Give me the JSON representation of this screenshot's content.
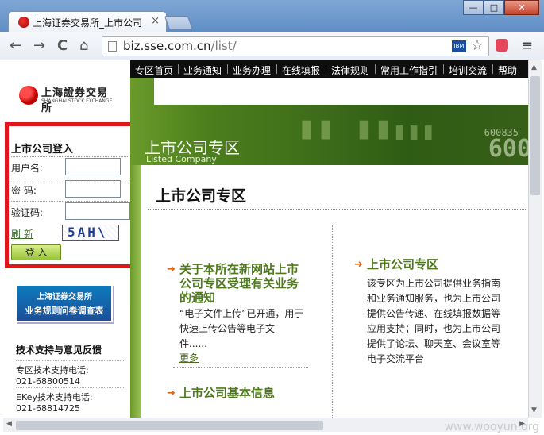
{
  "browser": {
    "tab_title": "上海证券交易所_上市公司",
    "tab_close": "×",
    "window_controls": {
      "minimize": "—",
      "maximize": "□",
      "close": "✕"
    },
    "nav": {
      "back": "←",
      "forward": "→",
      "reload": "C",
      "home": "⌂"
    },
    "url_host": "biz.sse.com.cn",
    "url_path": "/list/",
    "ibm_badge": "IBM",
    "star": "☆",
    "menu": "≡"
  },
  "logo": {
    "cn": "上海證券交易所",
    "en": "SHANGHAI STOCK EXCHANGE"
  },
  "login": {
    "title": "上市公司登入",
    "username_label": "用户名:",
    "password_label": "密  码:",
    "captcha_label": "验证码:",
    "refresh_label": "刷  新",
    "captcha_text": "5AH\\",
    "submit_label": "登  入"
  },
  "survey_banner": {
    "line1": "上海证券交易所",
    "line2": "业务规则问卷调查表"
  },
  "support": {
    "title": "技术支持与意见反馈",
    "lines": [
      "专区技术支持电话:",
      "021-68800514",
      "EKey技术支持电话:",
      "021-68814725"
    ]
  },
  "topnav": [
    "专区首页",
    "业务通知",
    "业务办理",
    "在线填报",
    "法律规则",
    "常用工作指引",
    "培训交流",
    "帮助"
  ],
  "banner": {
    "title_cn": "上市公司专区",
    "title_en": "Listed Company",
    "small_number": "600835",
    "big_number": "600"
  },
  "main": {
    "heading": "上市公司专区",
    "sections": [
      {
        "title_line1": "关于本所在新网站上市",
        "title_line2": "公司专区受理有关业务",
        "title_line3": "的通知",
        "body_line1": "“电子文件上传”已开通，用于",
        "body_line2": "快速上传公告等电子文",
        "body_line3": "件......",
        "more": "更多"
      },
      {
        "title": "上市公司专区",
        "body": [
          "该专区为上市公司提供业务指南",
          "和业务通知服务，也为上市公司",
          "提供公告传递、在线填报数据等",
          "应用支持；同时，也为上市公司",
          "提供了论坛、聊天室、会议室等",
          "电子交流平台"
        ]
      },
      {
        "title": "上市公司基本信息"
      }
    ]
  },
  "watermark": "www.wooyun.org"
}
